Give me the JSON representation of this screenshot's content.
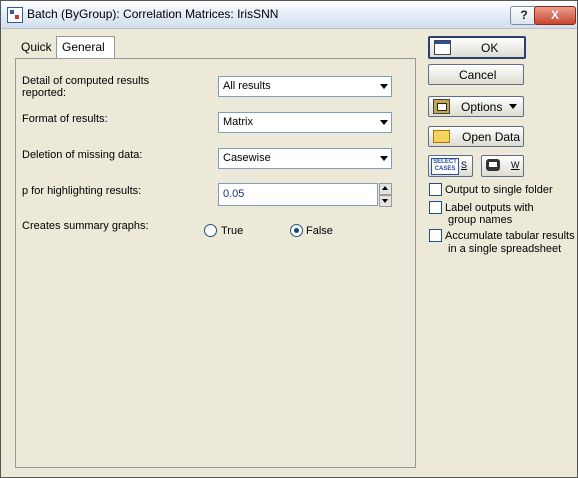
{
  "window": {
    "title": "Batch (ByGroup): Correlation Matrices: IrisSNN",
    "help_label": "?",
    "close_label": "X"
  },
  "tabs": [
    {
      "label": "Quick"
    },
    {
      "label": "General"
    }
  ],
  "form": {
    "detail_label": "Detail of computed results reported:",
    "detail_value": "All results",
    "format_label": "Format of results:",
    "format_value": "Matrix",
    "deletion_label": "Deletion of missing data:",
    "deletion_value": "Casewise",
    "p_label": "p for highlighting results:",
    "p_value": "0.05",
    "graphs_label": "Creates summary graphs:",
    "graphs_true_label": "True",
    "graphs_false_label": "False",
    "graphs_selected": "False"
  },
  "buttons": {
    "ok_label": "OK",
    "cancel_label": "Cancel",
    "options_label": "Options",
    "open_data_label": "Open Data",
    "select_cases_icon_text": "SELECT CASES",
    "select_cases_letter": "S",
    "weights_letter": "W"
  },
  "options": {
    "output_single_folder": "Output to single folder",
    "label_outputs_line1": "Label outputs with",
    "label_outputs_line2": "group names",
    "accumulate_line1": "Accumulate tabular results",
    "accumulate_line2": "in a single spreadsheet"
  }
}
